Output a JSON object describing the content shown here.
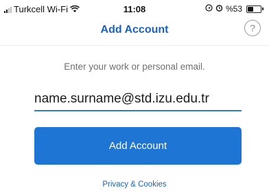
{
  "status_bar": {
    "carrier": "Turkcell Wi-Fi",
    "time": "11:08",
    "battery_percent": "%53",
    "battery_level": 0.53
  },
  "nav": {
    "title": "Add Account",
    "help_label": "?"
  },
  "form": {
    "prompt": "Enter your work or personal email.",
    "email_value": "name.surname@std.izu.edu.tr",
    "submit_label": "Add Account",
    "privacy_link": "Privacy & Cookies"
  },
  "colors": {
    "accent": "#1e75d4",
    "title_blue": "#1a63b8"
  },
  "icons": [
    "signal-icon",
    "wifi-icon",
    "location-icon",
    "alarm-icon",
    "battery-icon",
    "help-icon"
  ]
}
